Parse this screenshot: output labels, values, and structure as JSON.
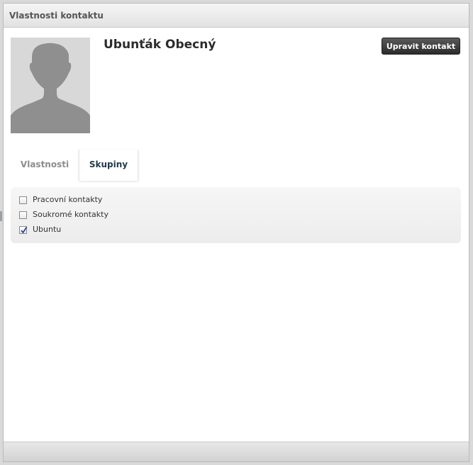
{
  "dialog": {
    "title": "Vlastnosti kontaktu"
  },
  "contact": {
    "name": "Ubunťák Obecný",
    "edit_button_label": "Upravit kontakt",
    "avatar": "default-person-avatar"
  },
  "tabs": [
    {
      "label": "Vlastnosti",
      "active": false
    },
    {
      "label": "Skupiny",
      "active": true
    }
  ],
  "groups": [
    {
      "label": "Pracovní kontakty",
      "checked": false
    },
    {
      "label": "Soukromé kontakty",
      "checked": false
    },
    {
      "label": "Ubuntu",
      "checked": true
    }
  ]
}
